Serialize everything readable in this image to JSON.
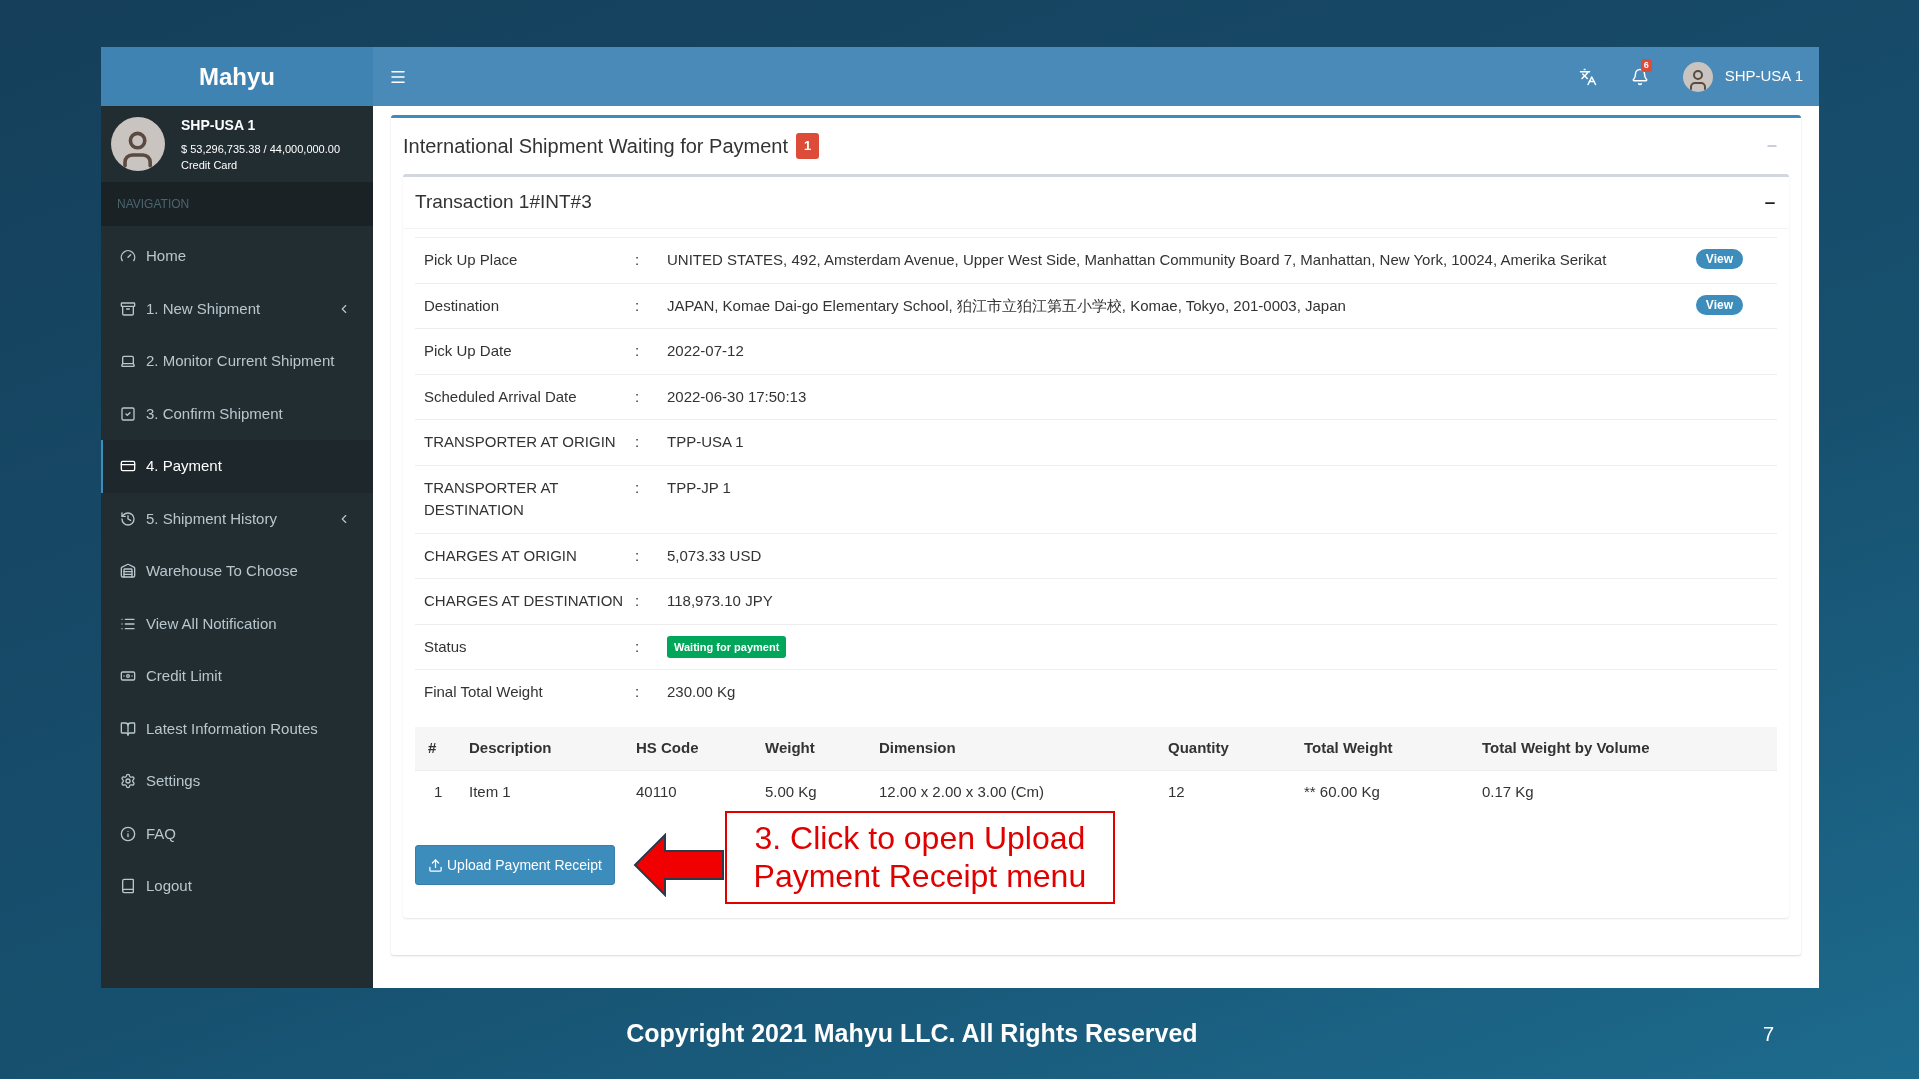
{
  "app": {
    "brand": "Mahyu"
  },
  "user_panel": {
    "name": "SHP-USA 1",
    "balance": "$ 53,296,735.38 / 44,000,000.00",
    "payment_method": "Credit Card"
  },
  "sidebar": {
    "header": "NAVIGATION",
    "items": [
      {
        "label": "Home",
        "selected": false,
        "has_submenu": false
      },
      {
        "label": "1. New Shipment",
        "selected": false,
        "has_submenu": true
      },
      {
        "label": "2. Monitor Current Shipment",
        "selected": false,
        "has_submenu": false
      },
      {
        "label": "3. Confirm Shipment",
        "selected": false,
        "has_submenu": false
      },
      {
        "label": "4. Payment",
        "selected": true,
        "has_submenu": false
      },
      {
        "label": "5. Shipment History",
        "selected": false,
        "has_submenu": true
      },
      {
        "label": "Warehouse To Choose",
        "selected": false,
        "has_submenu": false
      },
      {
        "label": "View All Notification",
        "selected": false,
        "has_submenu": false
      },
      {
        "label": "Credit Limit",
        "selected": false,
        "has_submenu": false
      },
      {
        "label": "Latest Information Routes",
        "selected": false,
        "has_submenu": false
      },
      {
        "label": "Settings",
        "selected": false,
        "has_submenu": false
      },
      {
        "label": "FAQ",
        "selected": false,
        "has_submenu": false
      },
      {
        "label": "Logout",
        "selected": false,
        "has_submenu": false
      }
    ]
  },
  "topbar": {
    "notification_count": "6",
    "user_name": "SHP-USA 1"
  },
  "panel": {
    "title": "International Shipment Waiting for Payment",
    "count": "1",
    "transaction": {
      "title": "Transaction 1#INT#3",
      "details": [
        {
          "kind": "text",
          "label": "Pick Up Place",
          "separator": ":",
          "value": "UNITED STATES, 492, Amsterdam Avenue, Upper West Side, Manhattan Community Board 7, Manhattan, New York, 10024, Amerika Serikat",
          "action": "View"
        },
        {
          "kind": "text",
          "label": "Destination",
          "separator": ":",
          "value": "JAPAN, Komae Dai-go Elementary School, 狛江市立狛江第五小学校, Komae, Tokyo, 201-0003, Japan",
          "action": "View"
        },
        {
          "kind": "text",
          "label": "Pick Up Date",
          "separator": ":",
          "value": "2022-07-12"
        },
        {
          "kind": "text",
          "label": "Scheduled Arrival Date",
          "separator": ":",
          "value": "2022-06-30 17:50:13"
        },
        {
          "kind": "text",
          "label": "TRANSPORTER AT ORIGIN",
          "separator": ":",
          "value": "TPP-USA 1"
        },
        {
          "kind": "text",
          "label": "TRANSPORTER AT DESTINATION",
          "separator": ":",
          "value": "TPP-JP 1"
        },
        {
          "kind": "text",
          "label": "CHARGES AT ORIGIN",
          "separator": ":",
          "value": "5,073.33 USD"
        },
        {
          "kind": "text",
          "label": "CHARGES AT DESTINATION",
          "separator": ":",
          "value": "118,973.10 JPY"
        },
        {
          "kind": "badge",
          "label": "Status",
          "separator": ":",
          "value": "Waiting for payment"
        },
        {
          "kind": "text",
          "label": "Final Total Weight",
          "separator": ":",
          "value": "230.00 Kg"
        }
      ],
      "items_table": {
        "columns": [
          "#",
          "Description",
          "HS Code",
          "Weight",
          "Dimension",
          "Quantity",
          "Total Weight",
          "Total Weight by Volume"
        ],
        "rows": [
          [
            "1",
            "Item 1",
            "40110",
            "5.00 Kg",
            "12.00 x 2.00 x 3.00 (Cm)",
            "12",
            "** 60.00 Kg",
            "0.17 Kg"
          ]
        ]
      },
      "upload_button": "Upload Payment Receipt"
    }
  },
  "annotation": {
    "text": "3. Click to open Upload Payment Receipt menu"
  },
  "footer": {
    "copyright": "Copyright 2021 Mahyu LLC. All Rights Reserved",
    "page_number": "7"
  }
}
